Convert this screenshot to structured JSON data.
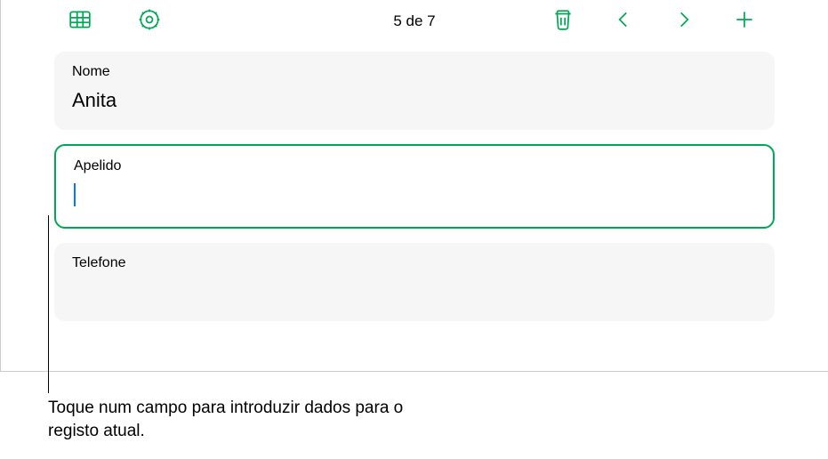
{
  "toolbar": {
    "position_label": "5 de 7"
  },
  "fields": {
    "nome": {
      "label": "Nome",
      "value": "Anita"
    },
    "apelido": {
      "label": "Apelido",
      "value": ""
    },
    "telefone": {
      "label": "Telefone",
      "value": ""
    }
  },
  "callout": {
    "text": "Toque num campo para introduzir dados para o registo atual."
  },
  "colors": {
    "accent": "#00a855"
  }
}
